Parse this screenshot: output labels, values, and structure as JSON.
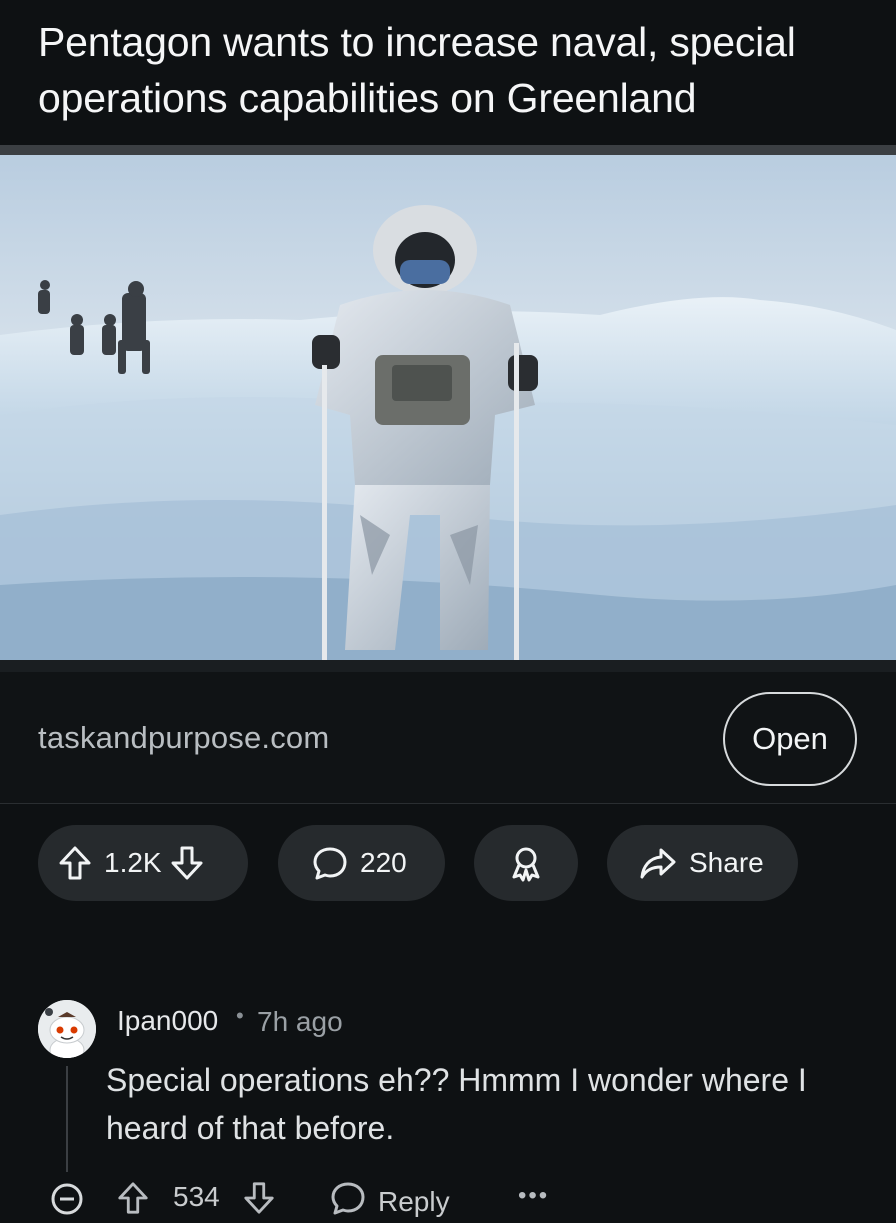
{
  "post": {
    "title": "Pentagon wants to increase naval, special operations capabilities on Greenland",
    "link_domain": "taskandpurpose.com",
    "open_label": "Open"
  },
  "actions": {
    "score": "1.2K",
    "comments": "220",
    "share_label": "Share"
  },
  "comment": {
    "author": "Ipan000",
    "separator": "•",
    "time": "7h ago",
    "body": "Special operations eh?? Hmmm I wonder where I heard of that before.",
    "score": "534",
    "reply_label": "Reply",
    "more": "•••"
  },
  "colors": {
    "background": "#0e1113",
    "pill": "#262a2d",
    "text": "#f2f4f5",
    "muted": "#9aa0a5"
  }
}
